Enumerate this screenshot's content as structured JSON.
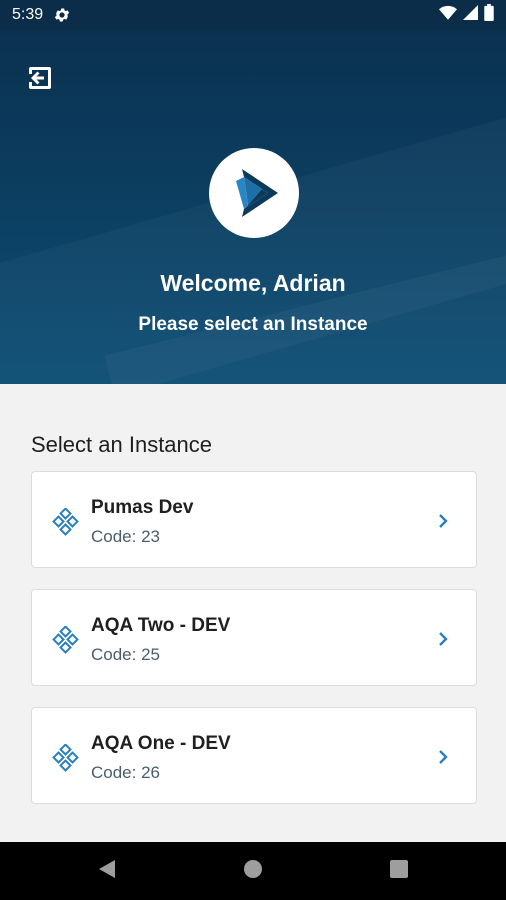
{
  "status_bar": {
    "time": "5:39",
    "icons": [
      "gear-icon",
      "wifi-icon",
      "signal-icon",
      "battery-icon"
    ]
  },
  "header": {
    "welcome": "Welcome, Adrian",
    "subtitle": "Please select an Instance",
    "logout_icon": "logout-icon",
    "gradient_top": "#0b3150",
    "gradient_bottom": "#0c4d74"
  },
  "main": {
    "section_title": "Select an Instance",
    "instances": [
      {
        "name": "Pumas Dev",
        "code": "Code: 23"
      },
      {
        "name": "AQA Two - DEV",
        "code": "Code: 25"
      },
      {
        "name": "AQA One - DEV",
        "code": "Code: 26"
      }
    ]
  },
  "nav_bar": {
    "buttons": [
      "back-icon",
      "home-icon",
      "recents-icon"
    ]
  },
  "colors": {
    "accent": "#2a7fc3",
    "background": "#f2f2f2",
    "text_secondary": "#4a5d6e"
  }
}
